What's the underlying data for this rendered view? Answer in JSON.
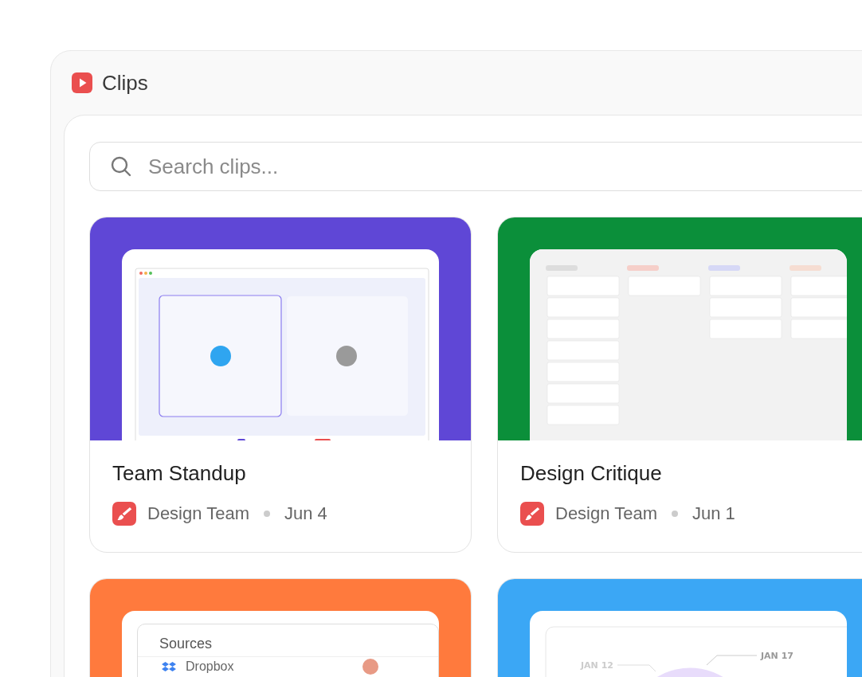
{
  "app": {
    "title": "Clips"
  },
  "search": {
    "placeholder": "Search clips..."
  },
  "clips": [
    {
      "kind": "call",
      "color": "#5f47d6",
      "title": "Team Standup",
      "team": "Design Team",
      "date": "Jun 4"
    },
    {
      "kind": "board",
      "color": "#0b8f3a",
      "title": "Design Critique",
      "team": "Design Team",
      "date": "Jun 1"
    },
    {
      "kind": "sources",
      "color": "#ff7a3d",
      "heading": "Sources",
      "item": "Dropbox"
    },
    {
      "kind": "chart",
      "color": "#3ba7f5",
      "labels": [
        "JAN 12",
        "JAN 17"
      ]
    }
  ]
}
